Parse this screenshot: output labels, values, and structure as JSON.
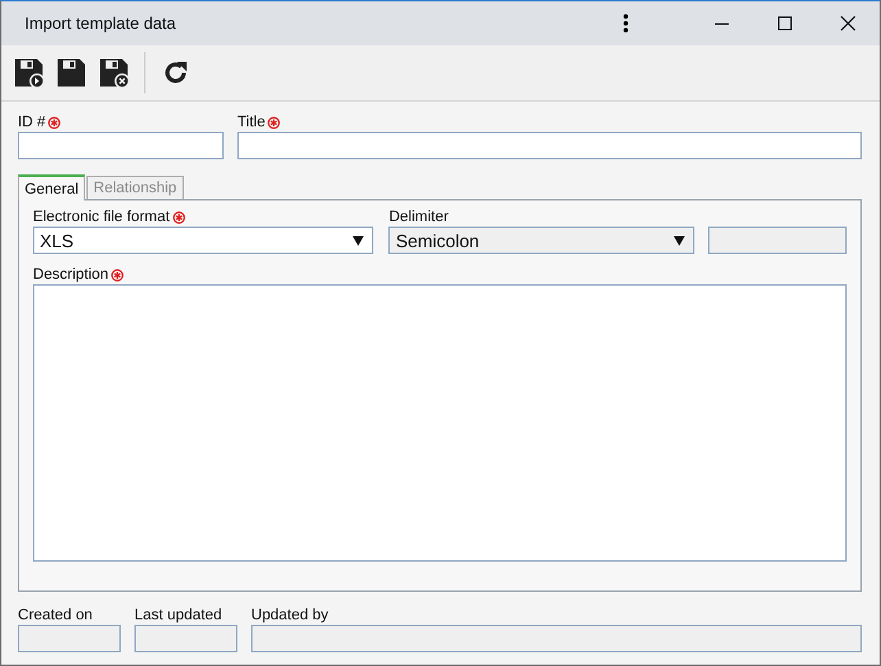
{
  "window": {
    "title": "Import template data"
  },
  "toolbar": [
    {
      "kind": "save-new"
    },
    {
      "kind": "save"
    },
    {
      "kind": "save-close"
    },
    {
      "kind": "separator"
    },
    {
      "kind": "refresh"
    }
  ],
  "header_fields": [
    {
      "label": "ID #",
      "required": true
    },
    {
      "label": "Title",
      "required": true
    }
  ],
  "tabs": [
    {
      "label": "General",
      "selected": true
    },
    {
      "label": "Relationship",
      "selected": false
    }
  ],
  "general": {
    "format": {
      "label": "Electronic file format",
      "required": true,
      "value": "XLS",
      "disabled": false
    },
    "delimiter": {
      "label": "Delimiter",
      "required": false,
      "value": "Semicolon",
      "disabled": true
    },
    "extra_field": {
      "disabled": true
    },
    "description": {
      "label": "Description",
      "required": true
    }
  },
  "footer_fields": [
    {
      "label": "Created on",
      "disabled": true
    },
    {
      "label": "Last updated",
      "disabled": true
    },
    {
      "label": "Updated by",
      "disabled": true
    }
  ]
}
